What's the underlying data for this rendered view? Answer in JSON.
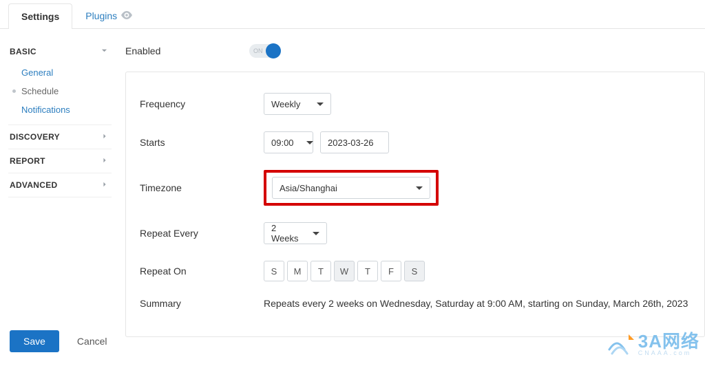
{
  "tabs": {
    "settings": "Settings",
    "plugins": "Plugins"
  },
  "sidebar": {
    "basic": {
      "label": "BASIC",
      "items": [
        "General",
        "Schedule",
        "Notifications"
      ],
      "active_index": 1
    },
    "discovery": {
      "label": "DISCOVERY"
    },
    "report": {
      "label": "REPORT"
    },
    "advanced": {
      "label": "ADVANCED"
    }
  },
  "form": {
    "enabled_label": "Enabled",
    "toggle_text": "ON",
    "frequency_label": "Frequency",
    "frequency_value": "Weekly",
    "starts_label": "Starts",
    "starts_time": "09:00",
    "starts_date": "2023-03-26",
    "timezone_label": "Timezone",
    "timezone_value": "Asia/Shanghai",
    "repeat_every_label": "Repeat Every",
    "repeat_every_value": "2 Weeks",
    "repeat_on_label": "Repeat On",
    "days": [
      "S",
      "M",
      "T",
      "W",
      "T",
      "F",
      "S"
    ],
    "days_selected": [
      false,
      false,
      false,
      true,
      false,
      false,
      true
    ],
    "summary_label": "Summary",
    "summary_text": "Repeats every 2 weeks on Wednesday, Saturday at 9:00 AM, starting on Sunday, March 26th, 2023"
  },
  "footer": {
    "save": "Save",
    "cancel": "Cancel"
  },
  "watermark": {
    "main": "3A网络",
    "sub": "CNAAA.com"
  }
}
